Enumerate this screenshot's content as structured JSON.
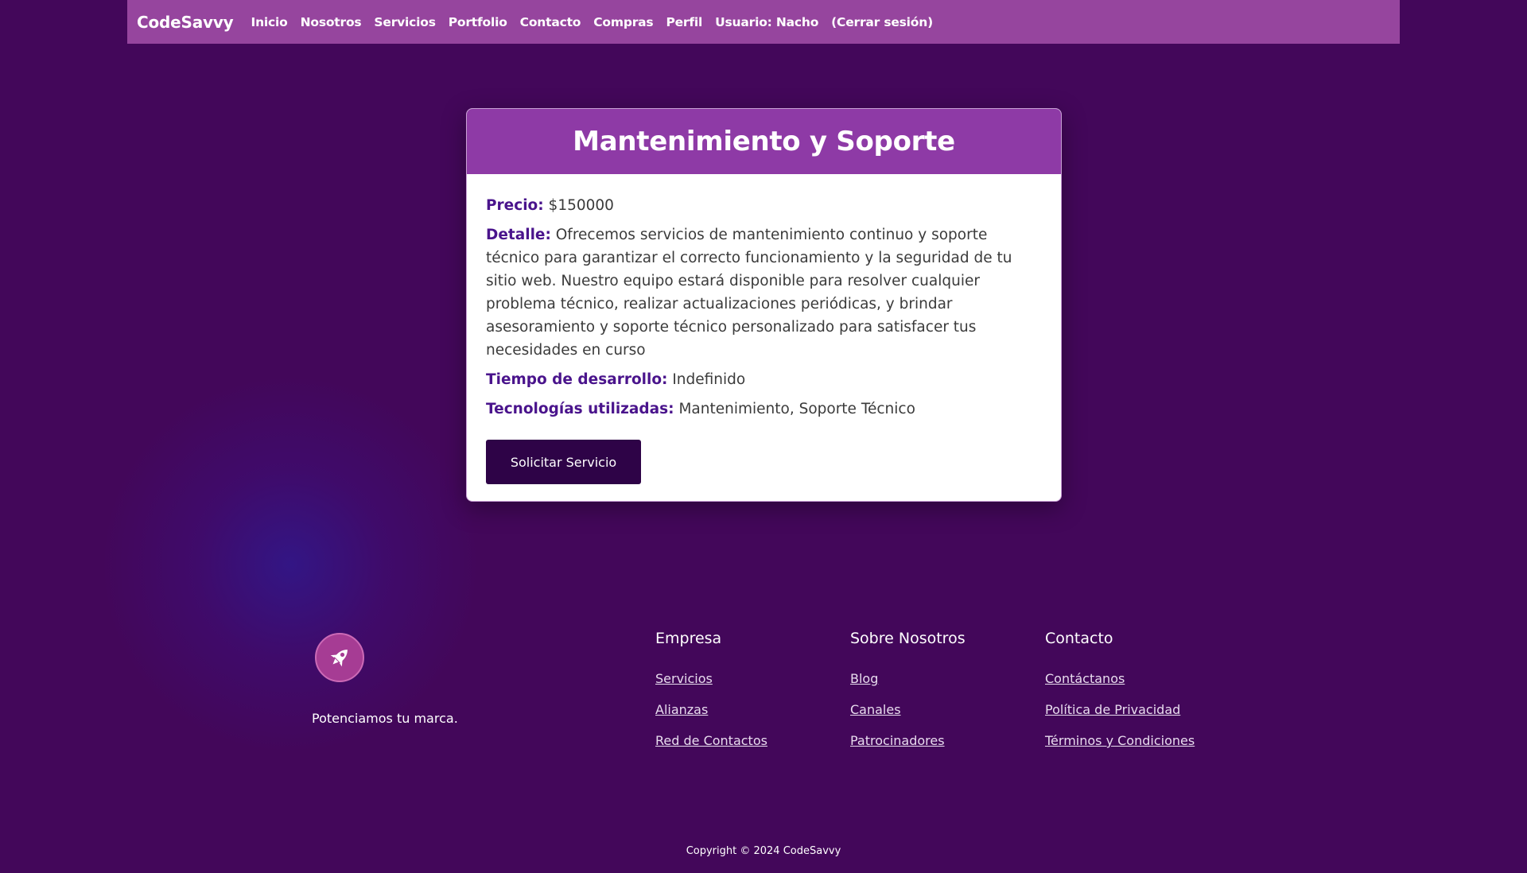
{
  "navbar": {
    "brand": "CodeSavvy",
    "links": [
      "Inicio",
      "Nosotros",
      "Servicios",
      "Portfolio",
      "Contacto",
      "Compras",
      "Perfil",
      "Usuario: Nacho",
      "(Cerrar sesión)"
    ]
  },
  "service": {
    "title": "Mantenimiento y Soporte",
    "precio_label": "Precio:",
    "precio_value": "$150000",
    "detalle_label": "Detalle:",
    "detalle_value": "Ofrecemos servicios de mantenimiento continuo y soporte técnico para garantizar el correcto funcionamiento y la seguridad de tu sitio web. Nuestro equipo estará disponible para resolver cualquier problema técnico, realizar actualizaciones periódicas, y brindar asesoramiento y soporte técnico personalizado para satisfacer tus necesidades en curso",
    "tiempo_label": "Tiempo de desarrollo:",
    "tiempo_value": "Indefinido",
    "tecnologias_label": "Tecnologías utilizadas:",
    "tecnologias_value": "Mantenimiento, Soporte Técnico",
    "button_label": "Solicitar Servicio"
  },
  "footer": {
    "logo_icon": "rocket-icon",
    "tagline": "Potenciamos tu marca.",
    "columns": [
      {
        "title": "Empresa",
        "links": [
          "Servicios",
          "Alianzas",
          "Red de Contactos"
        ]
      },
      {
        "title": "Sobre Nosotros",
        "links": [
          "Blog",
          "Canales",
          "Patrocinadores"
        ]
      },
      {
        "title": "Contacto",
        "links": [
          "Contáctanos",
          "Política de Privacidad",
          "Términos y Condiciones"
        ]
      }
    ],
    "copyright": "Copyright © 2024 CodeSavvy"
  },
  "colors": {
    "background": "#43075a",
    "navbar": "#96459e",
    "card_header": "#8e3aa6",
    "label": "#4a148c",
    "button": "#2e0347",
    "logo": "#a63c94"
  }
}
